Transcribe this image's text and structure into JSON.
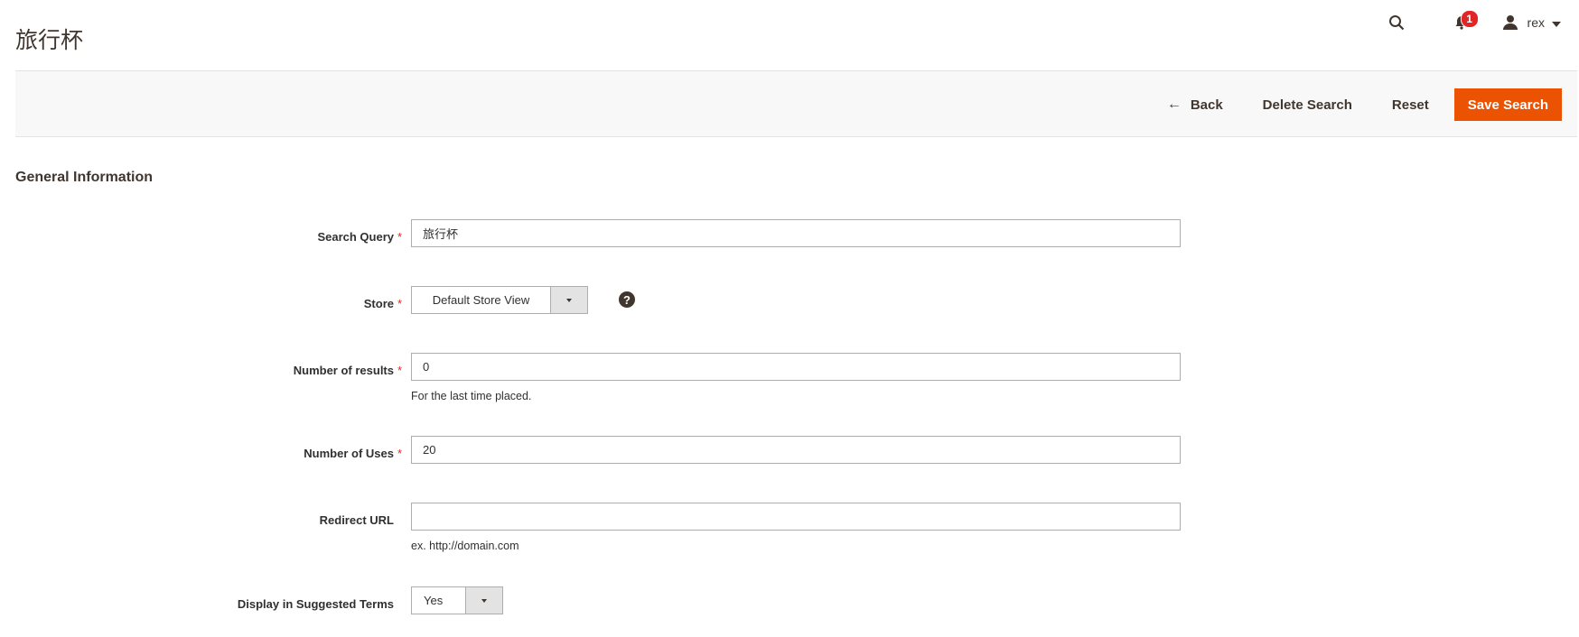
{
  "header": {
    "title": "旅行杯",
    "notifications_count": "1",
    "user_name": "rex",
    "icons": {
      "search": "search-icon",
      "notifications": "bell-icon",
      "user": "user-icon",
      "user_menu": "caret-down-icon"
    }
  },
  "page_actions": {
    "back_label": "Back",
    "delete_label": "Delete Search",
    "reset_label": "Reset",
    "save_label": "Save Search",
    "back_icon": "←"
  },
  "section": {
    "title": "General Information"
  },
  "form": {
    "search_query": {
      "label": "Search Query",
      "required": "*",
      "value": "旅行杯"
    },
    "store": {
      "label": "Store",
      "required": "*",
      "value": "Default Store View",
      "help": "?"
    },
    "num_results": {
      "label": "Number of results",
      "required": "*",
      "value": "0",
      "note": "For the last time placed."
    },
    "num_uses": {
      "label": "Number of Uses",
      "required": "*",
      "value": "20"
    },
    "redirect_url": {
      "label": "Redirect URL",
      "value": "",
      "note": "ex. http://domain.com"
    },
    "display_suggested": {
      "label": "Display in Suggested Terms",
      "value": "Yes"
    }
  },
  "colors": {
    "primary": "#eb5202",
    "required": "#e02b27",
    "badge": "#e22626",
    "text": "#41362f"
  }
}
